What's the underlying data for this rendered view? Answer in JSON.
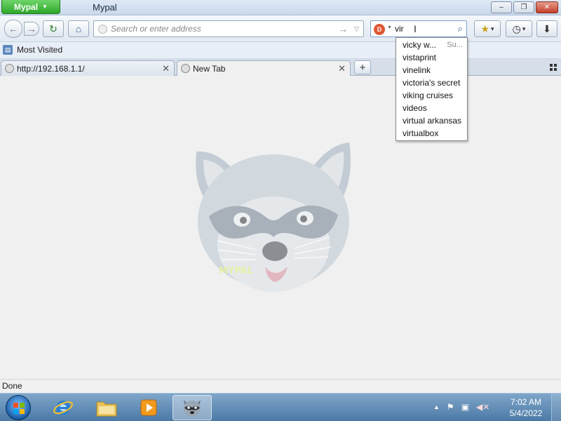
{
  "window": {
    "app_menu_label": "Mypal",
    "title": "Mypal",
    "controls": {
      "minimize": "–",
      "maximize": "❐",
      "close": "✕"
    }
  },
  "navbar": {
    "back_icon": "←",
    "forward_icon": "→",
    "reload_icon": "↻",
    "home_icon": "⌂",
    "url_placeholder": "Search or enter address",
    "url_value": "",
    "go_icon": "→",
    "dropdown_icon": "▽",
    "search_value": "vir",
    "search_cursor": "I",
    "search_icon": "⌕",
    "engine_label": "D",
    "engine_caret": "▼",
    "bookmark_icon": "★",
    "history_icon": "◷",
    "downloads_icon": "⬇",
    "toolbar_caret": "▾"
  },
  "bookmarks": {
    "most_visited_label": "Most Visited"
  },
  "tabs": [
    {
      "label": "http://192.168.1.1/",
      "close": "✕",
      "active": false
    },
    {
      "label": "New Tab",
      "close": "✕",
      "active": true
    }
  ],
  "new_tab_icon": "+",
  "search_suggestions": [
    {
      "text": "vicky w...",
      "hint": "Su..."
    },
    {
      "text": "vistaprint"
    },
    {
      "text": "vinelink"
    },
    {
      "text": "victoria's secret"
    },
    {
      "text": "viking cruises"
    },
    {
      "text": "videos"
    },
    {
      "text": "virtual arkansas"
    },
    {
      "text": "virtualbox"
    }
  ],
  "content": {
    "logo_icon": "raccoon-logo",
    "watermark_text": "MYPAL",
    "watermark_color": "#e6f0a8"
  },
  "statusbar": {
    "text": "Done"
  },
  "taskbar": {
    "clock_time": "7:02 AM",
    "clock_date": "5/4/2022",
    "tray_expand": "▲"
  },
  "colors": {
    "app_menu_green": "#2ea82a",
    "close_red": "#c4402a",
    "taskbar_blue": "#4b79a6",
    "engine_orange": "#de5833"
  }
}
